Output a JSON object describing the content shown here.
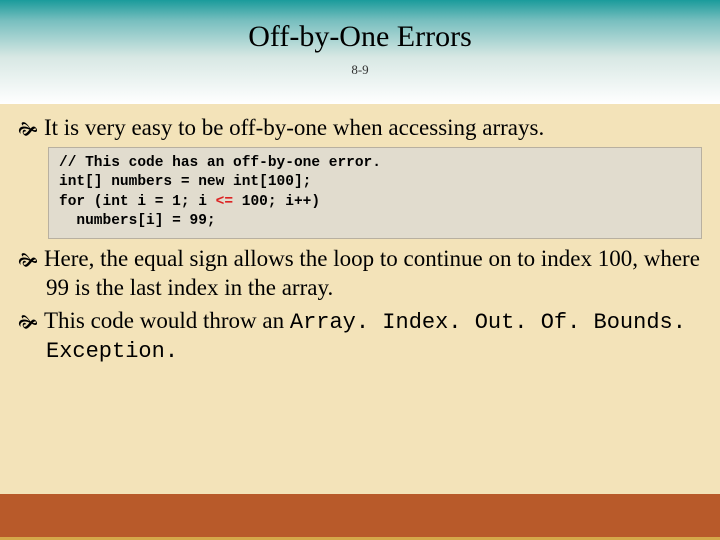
{
  "title": "Off-by-One Errors",
  "page_label": "8-9",
  "bullets": {
    "b1": "It is very easy to be off-by-one when accessing arrays.",
    "b2a": "Here, the equal sign allows the loop to continue on to index 100, where 99 is the last index in the array.",
    "b3a": "This code would throw an ",
    "b3b": "Array. Index. Out. Of. Bounds. Exception. "
  },
  "code": {
    "l1": "// This code has an off-by-one error.",
    "l2": "int[] numbers = new int[100];",
    "l3a": "for (int i = 1; i ",
    "l3op": "<=",
    "l3b": " 100; i++)",
    "l4": "  numbers[i] = 99;"
  },
  "chart_data": null
}
